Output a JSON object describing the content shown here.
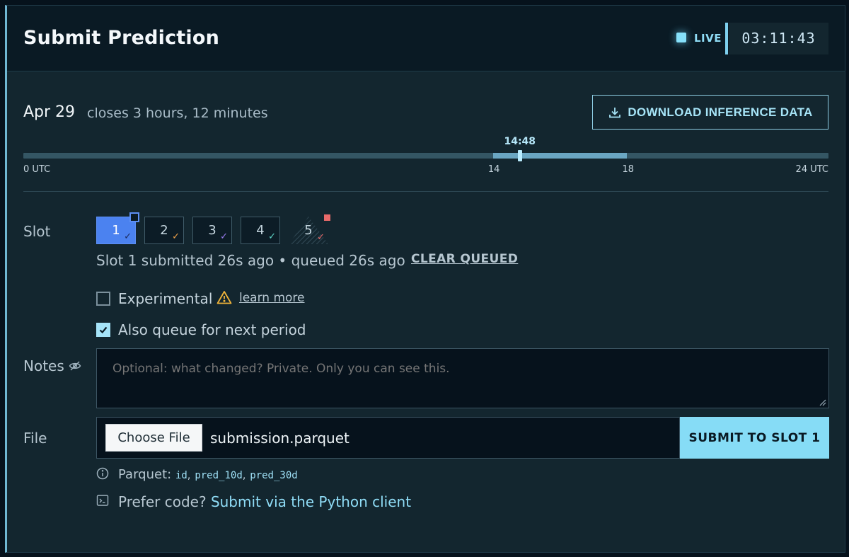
{
  "header": {
    "title": "Submit Prediction",
    "live_label": "LIVE",
    "timer": "03:11:43"
  },
  "period": {
    "date": "Apr 29",
    "closes": "closes 3 hours, 12 minutes",
    "download_label": "DOWNLOAD INFERENCE DATA"
  },
  "timeline": {
    "start_label": "0 UTC",
    "end_label": "24 UTC",
    "window_start_label": "14",
    "window_end_label": "18",
    "current_label": "14:48",
    "range_hours": [
      0,
      24
    ],
    "window_hours": [
      14,
      18
    ],
    "current_hour": 14.8
  },
  "slot": {
    "label": "Slot",
    "items": [
      {
        "label": "1",
        "check_color": "#1b2b60"
      },
      {
        "label": "2",
        "check_color": "#f0a24a"
      },
      {
        "label": "3",
        "check_color": "#9a7cf0"
      },
      {
        "label": "4",
        "check_color": "#5ed4c6"
      },
      {
        "label": "5",
        "check_color": "#e86a6a"
      }
    ],
    "check_glyph": "✓",
    "status": "Slot 1 submitted 26s ago • queued 26s ago",
    "clear_label": "CLEAR QUEUED"
  },
  "options": {
    "experimental_label": "Experimental",
    "learn_more": "learn more",
    "queue_next_label": "Also queue for next period"
  },
  "notes": {
    "label": "Notes",
    "placeholder": "Optional: what changed? Private. Only you can see this."
  },
  "file": {
    "label": "File",
    "choose_label": "Choose File",
    "file_name": "submission.parquet",
    "submit_label": "SUBMIT TO SLOT 1"
  },
  "help": {
    "parquet_prefix": "Parquet:",
    "columns": [
      "id",
      "pred_10d",
      "pred_30d"
    ],
    "prefer_text": "Prefer code?",
    "prefer_link": "Submit via the Python client"
  },
  "colors": {
    "accent": "#86dcf6",
    "active_slot": "#4b82f0",
    "warning": "#f0b43a"
  }
}
